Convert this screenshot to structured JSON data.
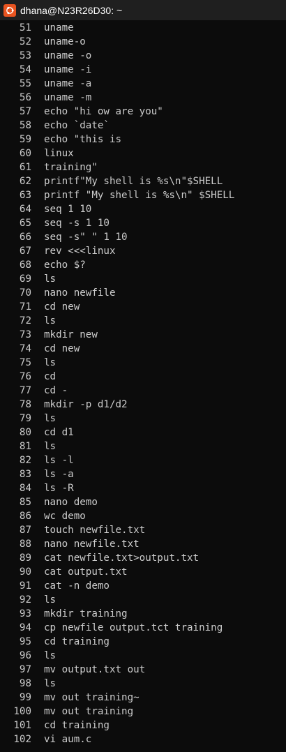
{
  "window": {
    "title": "dhana@N23R26D30: ~",
    "icon": "ubuntu-icon",
    "accent": "#e95420",
    "background": "#0c0c0c",
    "text_color": "#cccccc"
  },
  "history": [
    {
      "num": "51",
      "cmd": "uname"
    },
    {
      "num": "52",
      "cmd": "uname-o"
    },
    {
      "num": "53",
      "cmd": "uname -o"
    },
    {
      "num": "54",
      "cmd": "uname -i"
    },
    {
      "num": "55",
      "cmd": "uname -a"
    },
    {
      "num": "56",
      "cmd": "uname -m"
    },
    {
      "num": "57",
      "cmd": "echo \"hi ow are you\""
    },
    {
      "num": "58",
      "cmd": "echo `date`"
    },
    {
      "num": "59",
      "cmd": "echo \"this is"
    },
    {
      "num": "60",
      "cmd": "linux"
    },
    {
      "num": "61",
      "cmd": "training\""
    },
    {
      "num": "62",
      "cmd": "printf\"My shell is %s\\n\"$SHELL"
    },
    {
      "num": "63",
      "cmd": "printf \"My shell is %s\\n\" $SHELL"
    },
    {
      "num": "64",
      "cmd": "seq 1 10"
    },
    {
      "num": "65",
      "cmd": "seq -s 1 10"
    },
    {
      "num": "66",
      "cmd": "seq -s\" \" 1 10"
    },
    {
      "num": "67",
      "cmd": "rev <<<linux"
    },
    {
      "num": "68",
      "cmd": "echo $?"
    },
    {
      "num": "69",
      "cmd": "ls"
    },
    {
      "num": "70",
      "cmd": "nano newfile"
    },
    {
      "num": "71",
      "cmd": "cd new"
    },
    {
      "num": "72",
      "cmd": "ls"
    },
    {
      "num": "73",
      "cmd": "mkdir new"
    },
    {
      "num": "74",
      "cmd": "cd new"
    },
    {
      "num": "75",
      "cmd": "ls"
    },
    {
      "num": "76",
      "cmd": "cd"
    },
    {
      "num": "77",
      "cmd": "cd -"
    },
    {
      "num": "78",
      "cmd": "mkdir -p d1/d2"
    },
    {
      "num": "79",
      "cmd": "ls"
    },
    {
      "num": "80",
      "cmd": "cd d1"
    },
    {
      "num": "81",
      "cmd": "ls"
    },
    {
      "num": "82",
      "cmd": "ls -l"
    },
    {
      "num": "83",
      "cmd": "ls -a"
    },
    {
      "num": "84",
      "cmd": "ls -R"
    },
    {
      "num": "85",
      "cmd": "nano demo"
    },
    {
      "num": "86",
      "cmd": "wc demo"
    },
    {
      "num": "87",
      "cmd": "touch newfile.txt"
    },
    {
      "num": "88",
      "cmd": "nano newfile.txt"
    },
    {
      "num": "89",
      "cmd": "cat newfile.txt>output.txt"
    },
    {
      "num": "90",
      "cmd": "cat output.txt"
    },
    {
      "num": "91",
      "cmd": "cat -n demo"
    },
    {
      "num": "92",
      "cmd": "ls"
    },
    {
      "num": "93",
      "cmd": "mkdir training"
    },
    {
      "num": "94",
      "cmd": "cp newfile output.tct training"
    },
    {
      "num": "95",
      "cmd": "cd training"
    },
    {
      "num": "96",
      "cmd": "ls"
    },
    {
      "num": "97",
      "cmd": "mv output.txt out"
    },
    {
      "num": "98",
      "cmd": "ls"
    },
    {
      "num": "99",
      "cmd": "mv out training~"
    },
    {
      "num": "100",
      "cmd": "mv out training"
    },
    {
      "num": "101",
      "cmd": "cd training"
    },
    {
      "num": "102",
      "cmd": "vi aum.c"
    }
  ]
}
